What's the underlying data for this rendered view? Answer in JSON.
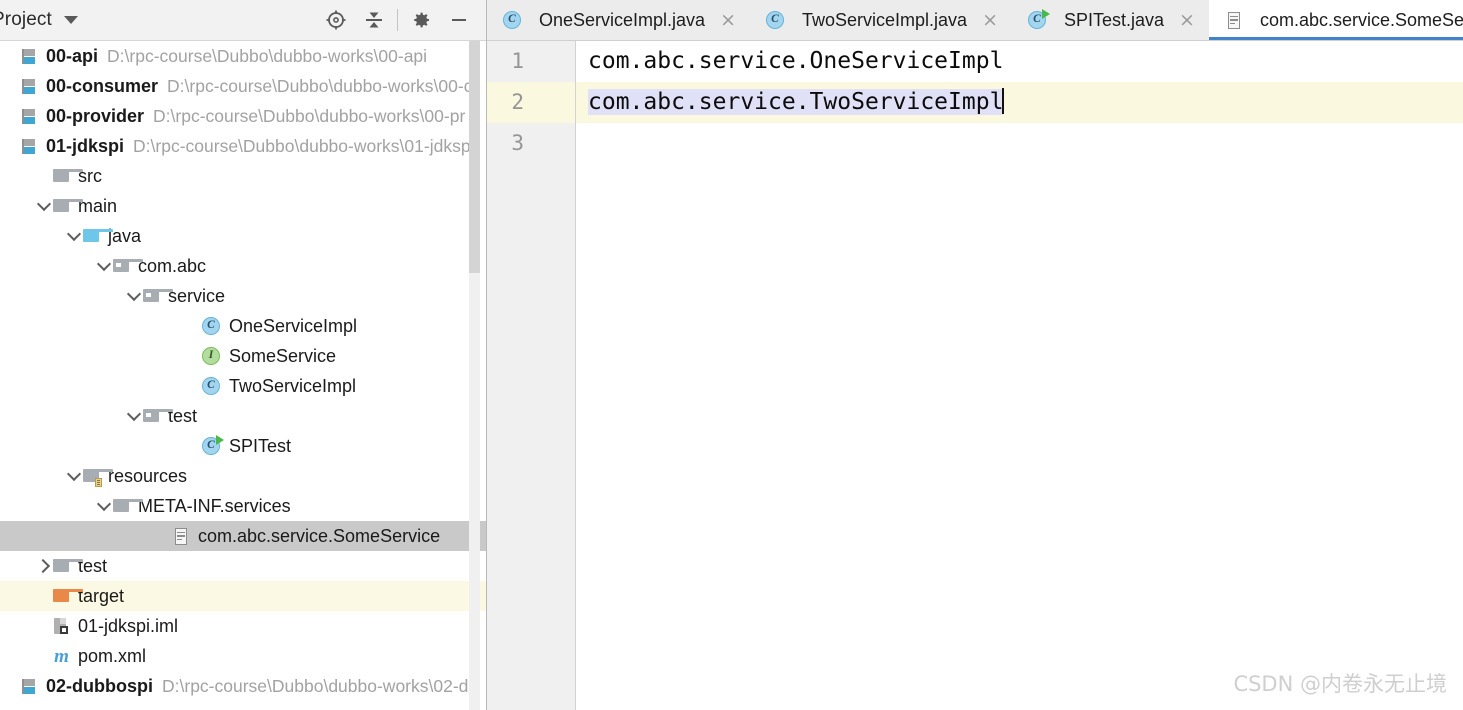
{
  "panel": {
    "title": "Project",
    "dropdown_icon": "chevron-down-icon",
    "tools": [
      {
        "name": "select-opened-file-icon",
        "label": "Select Opened File"
      },
      {
        "name": "collapse-all-icon",
        "label": "Collapse All"
      },
      {
        "name": "settings-gear-icon",
        "label": "Settings"
      },
      {
        "name": "hide-panel-icon",
        "label": "Hide"
      }
    ]
  },
  "tree": [
    {
      "indent": 0,
      "arrow": "none",
      "icon": "module-icon",
      "label": "00-api",
      "bold": true,
      "path": "D:\\rpc-course\\Dubbo\\dubbo-works\\00-api",
      "state": "normal"
    },
    {
      "indent": 0,
      "arrow": "none",
      "icon": "module-icon",
      "label": "00-consumer",
      "bold": true,
      "path": "D:\\rpc-course\\Dubbo\\dubbo-works\\00-c",
      "state": "normal"
    },
    {
      "indent": 0,
      "arrow": "none",
      "icon": "module-icon",
      "label": "00-provider",
      "bold": true,
      "path": "D:\\rpc-course\\Dubbo\\dubbo-works\\00-pr",
      "state": "normal"
    },
    {
      "indent": 0,
      "arrow": "none",
      "icon": "module-icon",
      "label": "01-jdkspi",
      "bold": true,
      "path": "D:\\rpc-course\\Dubbo\\dubbo-works\\01-jdksp",
      "state": "normal"
    },
    {
      "indent": 1,
      "arrow": "none",
      "icon": "folder-icon",
      "label": "src",
      "bold": false,
      "path": "",
      "state": "normal"
    },
    {
      "indent": 1,
      "arrow": "down",
      "icon": "folder-icon",
      "label": "main",
      "bold": false,
      "path": "",
      "state": "normal"
    },
    {
      "indent": 2,
      "arrow": "down",
      "icon": "source-folder-icon",
      "label": "java",
      "bold": false,
      "path": "",
      "state": "normal"
    },
    {
      "indent": 3,
      "arrow": "down",
      "icon": "package-icon",
      "label": "com.abc",
      "bold": false,
      "path": "",
      "state": "normal"
    },
    {
      "indent": 4,
      "arrow": "down",
      "icon": "package-icon",
      "label": "service",
      "bold": false,
      "path": "",
      "state": "normal"
    },
    {
      "indent": 6,
      "arrow": "none",
      "icon": "java-class-icon",
      "label": "OneServiceImpl",
      "bold": false,
      "path": "",
      "state": "normal"
    },
    {
      "indent": 6,
      "arrow": "none",
      "icon": "java-interface-icon",
      "label": "SomeService",
      "bold": false,
      "path": "",
      "state": "normal"
    },
    {
      "indent": 6,
      "arrow": "none",
      "icon": "java-class-icon",
      "label": "TwoServiceImpl",
      "bold": false,
      "path": "",
      "state": "normal"
    },
    {
      "indent": 4,
      "arrow": "down",
      "icon": "package-icon",
      "label": "test",
      "bold": false,
      "path": "",
      "state": "normal"
    },
    {
      "indent": 6,
      "arrow": "none",
      "icon": "java-runnable-class-icon",
      "label": "SPITest",
      "bold": false,
      "path": "",
      "state": "normal"
    },
    {
      "indent": 2,
      "arrow": "down",
      "icon": "resources-folder-icon",
      "label": "resources",
      "bold": false,
      "path": "",
      "state": "normal"
    },
    {
      "indent": 3,
      "arrow": "down",
      "icon": "folder-icon",
      "label": "META-INF.services",
      "bold": false,
      "path": "",
      "state": "normal"
    },
    {
      "indent": 5,
      "arrow": "none",
      "icon": "text-file-icon",
      "label": "com.abc.service.SomeService",
      "bold": false,
      "path": "",
      "state": "selected"
    },
    {
      "indent": 1,
      "arrow": "right",
      "icon": "folder-icon",
      "label": "test",
      "bold": false,
      "path": "",
      "state": "normal"
    },
    {
      "indent": 1,
      "arrow": "none",
      "icon": "excluded-folder-icon",
      "label": "target",
      "bold": false,
      "path": "",
      "state": "excluded"
    },
    {
      "indent": 1,
      "arrow": "none",
      "icon": "iml-file-icon",
      "label": "01-jdkspi.iml",
      "bold": false,
      "path": "",
      "state": "normal"
    },
    {
      "indent": 1,
      "arrow": "none",
      "icon": "maven-pom-icon",
      "label": "pom.xml",
      "bold": false,
      "path": "",
      "state": "normal"
    },
    {
      "indent": 0,
      "arrow": "none",
      "icon": "module-icon",
      "label": "02-dubbospi",
      "bold": true,
      "path": "D:\\rpc-course\\Dubbo\\dubbo-works\\02-d",
      "state": "normal"
    }
  ],
  "tabs": [
    {
      "label": "OneServiceImpl.java",
      "icon": "java-class-icon",
      "active": false,
      "close": "×"
    },
    {
      "label": "TwoServiceImpl.java",
      "icon": "java-class-icon",
      "active": false,
      "close": "×"
    },
    {
      "label": "SPITest.java",
      "icon": "java-runnable-class-icon",
      "active": false,
      "close": "×"
    },
    {
      "label": "com.abc.service.SomeService",
      "icon": "text-file-icon",
      "active": true,
      "close": "×"
    }
  ],
  "editor": {
    "line_numbers": [
      "1",
      "2",
      "3"
    ],
    "lines": [
      {
        "text": "com.abc.service.OneServiceImpl",
        "selected": false,
        "caret_line": false
      },
      {
        "text": "com.abc.service.TwoServiceImpl",
        "selected": true,
        "caret_line": true
      },
      {
        "text": "",
        "selected": false,
        "caret_line": false
      }
    ],
    "selection_color": "#e0e0f7",
    "caret_line_color": "#faf8df",
    "active_tab_underline_color": "#4282c8"
  },
  "watermark": "CSDN @内卷永无止境"
}
